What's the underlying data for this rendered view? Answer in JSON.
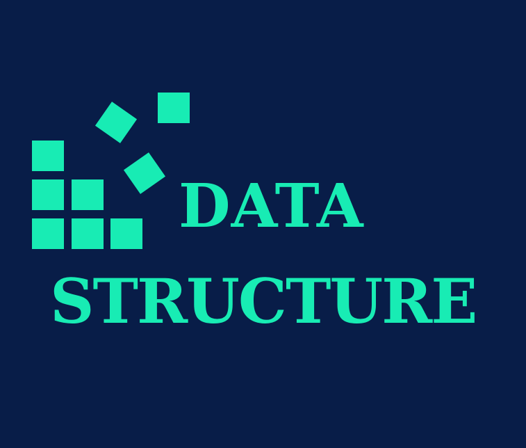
{
  "logo": {
    "line_1": "DATA",
    "line_2": "STRUCTURE"
  },
  "colors": {
    "background": "#081d48",
    "accent": "#18ecb4"
  }
}
